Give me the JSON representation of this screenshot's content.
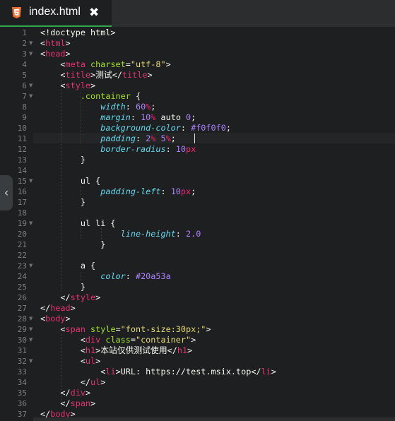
{
  "tab": {
    "label": "index.html",
    "close": "✖",
    "icon": "html5-icon"
  },
  "sidebar_toggle": {
    "glyph": "‹",
    "icon": "chevron-left-icon"
  },
  "colors": {
    "background": "#1d1f20",
    "tab_bar": "#2b2d2e",
    "tab_underline": "#2fa84f",
    "tag": "#e5326f",
    "attribute": "#a6e22e",
    "string": "#e6db74",
    "property": "#66d9ef",
    "number": "#ae81ff"
  },
  "line_numbers": [
    "1",
    "2",
    "3",
    "4",
    "5",
    "6",
    "7",
    "8",
    "9",
    "10",
    "11",
    "12",
    "13",
    "14",
    "15",
    "16",
    "17",
    "18",
    "19",
    "20",
    "21",
    "22",
    "23",
    "24",
    "25",
    "26",
    "27",
    "28",
    "29",
    "30",
    "31",
    "32",
    "33",
    "34",
    "35",
    "36",
    "37"
  ],
  "code": [
    [
      [
        "plain",
        "<!doctype html>"
      ]
    ],
    [
      [
        "plain",
        "<"
      ],
      [
        "tag",
        "html"
      ],
      [
        "plain",
        ">"
      ]
    ],
    [
      [
        "plain",
        "<"
      ],
      [
        "tag",
        "head"
      ],
      [
        "plain",
        ">"
      ]
    ],
    [
      [
        "plain",
        "    <"
      ],
      [
        "tag",
        "meta"
      ],
      [
        "plain",
        " "
      ],
      [
        "attr",
        "charset"
      ],
      [
        "plain",
        "="
      ],
      [
        "str",
        "\"utf-8\""
      ],
      [
        "plain",
        ">"
      ]
    ],
    [
      [
        "plain",
        "    <"
      ],
      [
        "tag",
        "title"
      ],
      [
        "plain",
        ">测试</"
      ],
      [
        "tag",
        "title"
      ],
      [
        "plain",
        ">"
      ]
    ],
    [
      [
        "plain",
        "    <"
      ],
      [
        "tag",
        "style"
      ],
      [
        "plain",
        ">"
      ]
    ],
    [
      [
        "plain",
        "        "
      ],
      [
        "sel",
        ".container"
      ],
      [
        "plain",
        " {"
      ]
    ],
    [
      [
        "plain",
        "            "
      ],
      [
        "prop",
        "width"
      ],
      [
        "plain",
        ": "
      ],
      [
        "num",
        "60"
      ],
      [
        "unit",
        "%"
      ],
      [
        "plain",
        ";"
      ]
    ],
    [
      [
        "plain",
        "            "
      ],
      [
        "prop",
        "margin"
      ],
      [
        "plain",
        ": "
      ],
      [
        "num",
        "10"
      ],
      [
        "unit",
        "%"
      ],
      [
        "plain",
        " auto "
      ],
      [
        "num",
        "0"
      ],
      [
        "plain",
        ";"
      ]
    ],
    [
      [
        "plain",
        "            "
      ],
      [
        "prop",
        "background-color"
      ],
      [
        "plain",
        ": "
      ],
      [
        "num",
        "#f0f0f0"
      ],
      [
        "plain",
        ";"
      ]
    ],
    [
      [
        "plain",
        "            "
      ],
      [
        "prop",
        "padding"
      ],
      [
        "plain",
        ": "
      ],
      [
        "num",
        "2"
      ],
      [
        "unit",
        "%"
      ],
      [
        "plain",
        " "
      ],
      [
        "num",
        "5"
      ],
      [
        "unit",
        "%"
      ],
      [
        "plain",
        ";"
      ]
    ],
    [
      [
        "plain",
        "            "
      ],
      [
        "prop",
        "border-radius"
      ],
      [
        "plain",
        ": "
      ],
      [
        "num",
        "10"
      ],
      [
        "unit",
        "px"
      ]
    ],
    [
      [
        "plain",
        "        }"
      ]
    ],
    [
      [
        "plain",
        ""
      ]
    ],
    [
      [
        "plain",
        "        ul {"
      ]
    ],
    [
      [
        "plain",
        "            "
      ],
      [
        "prop",
        "padding-left"
      ],
      [
        "plain",
        ": "
      ],
      [
        "num",
        "10"
      ],
      [
        "unit",
        "px"
      ],
      [
        "plain",
        ";"
      ]
    ],
    [
      [
        "plain",
        "        }"
      ]
    ],
    [
      [
        "plain",
        ""
      ]
    ],
    [
      [
        "plain",
        "        ul li {"
      ]
    ],
    [
      [
        "plain",
        "                "
      ],
      [
        "prop",
        "line-height"
      ],
      [
        "plain",
        ": "
      ],
      [
        "num",
        "2.0"
      ]
    ],
    [
      [
        "plain",
        "            }"
      ]
    ],
    [
      [
        "plain",
        ""
      ]
    ],
    [
      [
        "plain",
        "        a {"
      ]
    ],
    [
      [
        "plain",
        "            "
      ],
      [
        "prop",
        "color"
      ],
      [
        "plain",
        ": "
      ],
      [
        "num",
        "#20a53a"
      ]
    ],
    [
      [
        "plain",
        "        }"
      ]
    ],
    [
      [
        "plain",
        "    </"
      ],
      [
        "tag",
        "style"
      ],
      [
        "plain",
        ">"
      ]
    ],
    [
      [
        "plain",
        "</"
      ],
      [
        "tag",
        "head"
      ],
      [
        "plain",
        ">"
      ]
    ],
    [
      [
        "plain",
        "<"
      ],
      [
        "tag",
        "body"
      ],
      [
        "plain",
        ">"
      ]
    ],
    [
      [
        "plain",
        "    <"
      ],
      [
        "tag",
        "span"
      ],
      [
        "plain",
        " "
      ],
      [
        "attr",
        "style"
      ],
      [
        "plain",
        "="
      ],
      [
        "str",
        "\"font-size:30px;\""
      ],
      [
        "plain",
        ">"
      ]
    ],
    [
      [
        "plain",
        "        <"
      ],
      [
        "tag",
        "div"
      ],
      [
        "plain",
        " "
      ],
      [
        "attr",
        "class"
      ],
      [
        "plain",
        "="
      ],
      [
        "str",
        "\"container\""
      ],
      [
        "plain",
        ">"
      ]
    ],
    [
      [
        "plain",
        "        <"
      ],
      [
        "tag",
        "h1"
      ],
      [
        "plain",
        ">本站仅供测试使用</"
      ],
      [
        "tag",
        "h1"
      ],
      [
        "plain",
        ">"
      ]
    ],
    [
      [
        "plain",
        "        <"
      ],
      [
        "tag",
        "ul"
      ],
      [
        "plain",
        ">"
      ]
    ],
    [
      [
        "plain",
        "            <"
      ],
      [
        "tag",
        "li"
      ],
      [
        "plain",
        ">URL: https://test.msix.top</"
      ],
      [
        "tag",
        "li"
      ],
      [
        "plain",
        ">"
      ]
    ],
    [
      [
        "plain",
        "        </"
      ],
      [
        "tag",
        "ul"
      ],
      [
        "plain",
        ">"
      ]
    ],
    [
      [
        "plain",
        "    </"
      ],
      [
        "tag",
        "div"
      ],
      [
        "plain",
        ">"
      ]
    ],
    [
      [
        "plain",
        "    </"
      ],
      [
        "tag",
        "span"
      ],
      [
        "plain",
        ">"
      ]
    ],
    [
      [
        "plain",
        "</"
      ],
      [
        "tag",
        "body"
      ],
      [
        "plain",
        ">"
      ]
    ]
  ]
}
